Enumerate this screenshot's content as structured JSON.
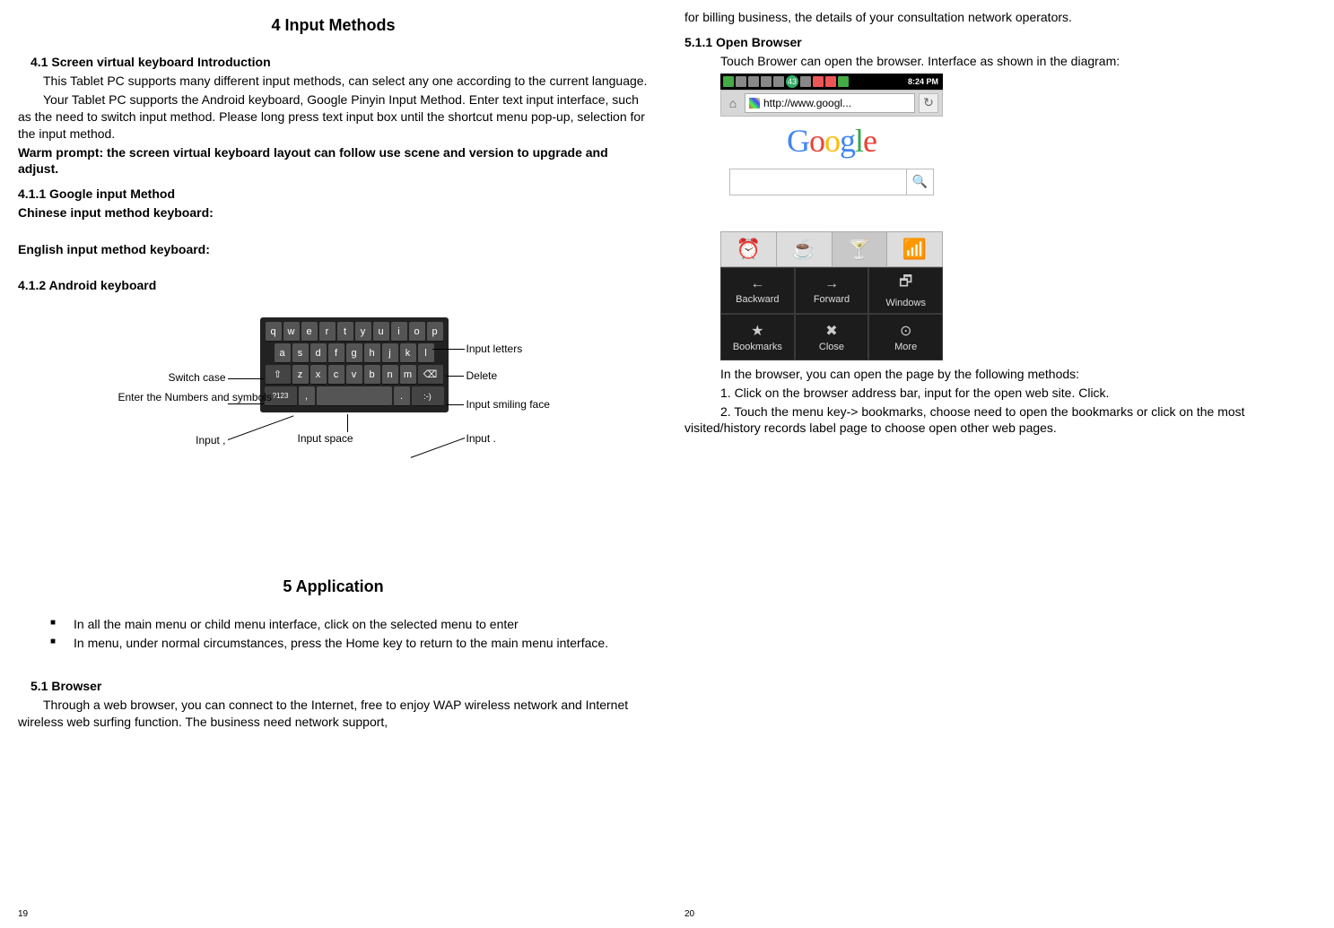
{
  "left": {
    "chapter4_title": "4    Input Methods",
    "sec41_heading": "4.1    Screen virtual keyboard Introduction",
    "sec41_p1": "This Tablet PC supports many different input methods, can select any one according to the current language.",
    "sec41_p2": "Your Tablet PC supports the Android keyboard, Google Pinyin Input Method. Enter text input interface, such as the need to switch input method. Please long press text input box until the shortcut menu pop-up, selection for the input method.",
    "sec41_warm": "Warm prompt: the screen virtual keyboard layout can follow use scene and version to upgrade and adjust.",
    "sec411_heading": "4.1.1    Google input Method",
    "sec411_chinese": "Chinese input method keyboard:",
    "sec411_english": "English input method keyboard:",
    "sec412_heading": "4.1.2    Android keyboard",
    "kb_labels": {
      "switch_case": "Switch case",
      "enter_nums": "Enter the Numbers and symbols",
      "input_left": "Input ,",
      "input_letters": "Input letters",
      "delete": "Delete",
      "input_smile": "Input smiling face",
      "input_right": "Input .",
      "input_space": "Input space"
    },
    "kb_keys": {
      "row1": [
        "q",
        "w",
        "e",
        "r",
        "t",
        "y",
        "u",
        "i",
        "o",
        "p"
      ],
      "row2": [
        "a",
        "s",
        "d",
        "f",
        "g",
        "h",
        "j",
        "k",
        "l"
      ],
      "row3_mid": [
        "z",
        "x",
        "c",
        "v",
        "b",
        "n",
        "m"
      ],
      "shift": "⇧",
      "del": "⌫",
      "sym": "?123",
      "comma": ",",
      "smile": ":-)",
      "period": "."
    },
    "chapter5_title": "5    Application",
    "bul1": "In all the main menu or child menu interface, click on the selected menu to enter",
    "bul2": "In menu, under normal circumstances, press the Home key to return to the main menu interface.",
    "sec51_heading": "5.1        Browser",
    "sec51_p1": "Through a web browser, you can connect to the Internet, free to enjoy WAP wireless network and Internet wireless web surfing function. The business need network support,",
    "page_num": "19"
  },
  "right": {
    "cont_p": "for billing business, the details of your consultation network operators.",
    "sec511_heading": "5.1.1    Open Browser",
    "sec511_p1": "Touch Brower can open the browser. Interface as shown in the diagram:",
    "browser": {
      "status_badge": "43",
      "time": "8:24 PM",
      "url": "http://www.googl..."
    },
    "menu": {
      "tabs_icons": [
        "⏰",
        "☕",
        "🍸",
        "📶"
      ],
      "cells": [
        {
          "icon": "←",
          "label": "Backward"
        },
        {
          "icon": "→",
          "label": "Forward"
        },
        {
          "icon": "🗗",
          "label": "Windows"
        },
        {
          "icon": "★",
          "label": "Bookmarks"
        },
        {
          "icon": "✖",
          "label": "Close"
        },
        {
          "icon": "⊙",
          "label": "More"
        }
      ]
    },
    "after_p1": "In the browser, you can open the page by the following methods:",
    "after_p2": "1. Click on the browser address bar, input for the open web site. Click.",
    "after_p3": "2. Touch the menu key-> bookmarks, choose need to open the bookmarks or click on the most visited/history records label page to choose open other web pages.",
    "page_num": "20"
  }
}
